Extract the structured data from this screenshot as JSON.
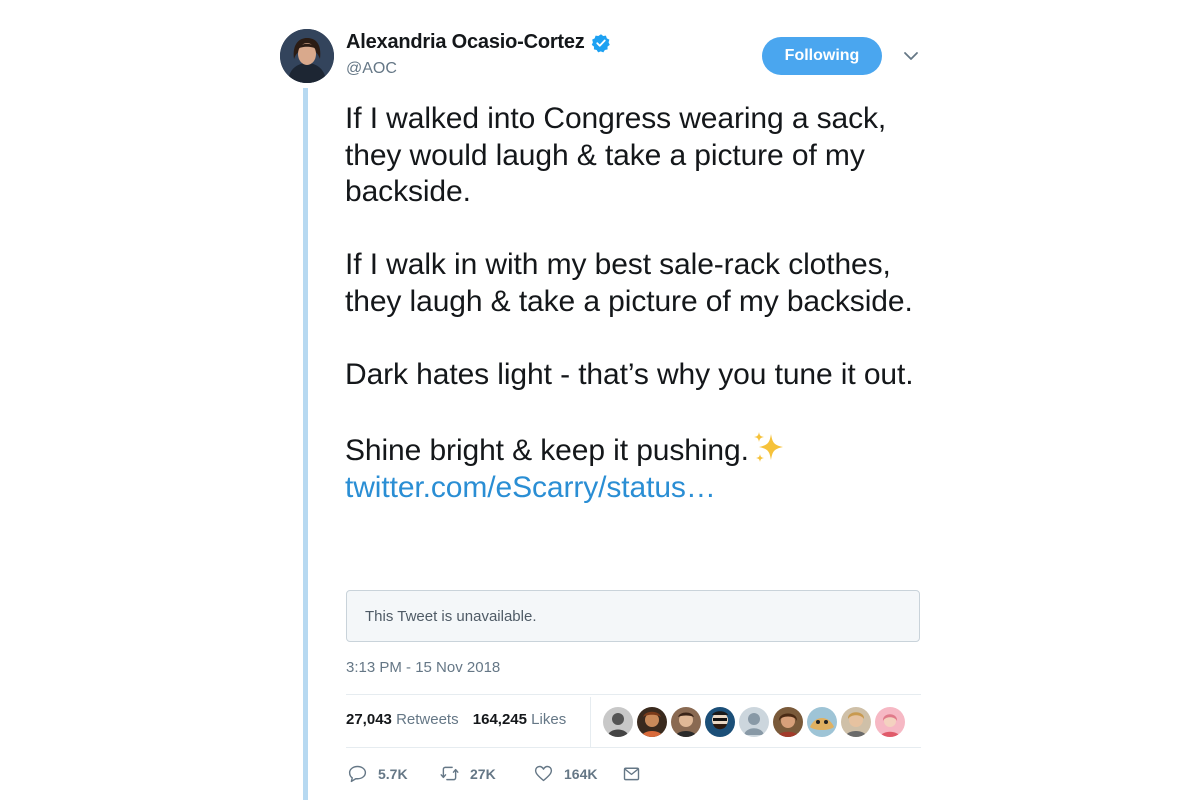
{
  "author": {
    "name": "Alexandria Ocasio-Cortez",
    "handle": "@AOC",
    "avatar_icon": "profile-photo"
  },
  "follow_button_label": "Following",
  "tweet": {
    "paragraphs": [
      "If I walked into Congress wearing a sack, they would laugh & take a picture of my backside.",
      "If I walk in with my best sale-rack clothes, they laugh & take a picture of my backside.",
      "Dark hates light - that’s why you tune it out.",
      "Shine bright & keep it pushing."
    ],
    "emoji": "sparkles",
    "link": "twitter.com/eScarry/status…"
  },
  "quote_card": {
    "text": "This Tweet is unavailable."
  },
  "timestamp": "3:13 PM - 15 Nov 2018",
  "stats": {
    "retweets_count": "27,043",
    "retweets_label": "Retweets",
    "likes_count": "164,245",
    "likes_label": "Likes"
  },
  "likers": [
    "liker-1",
    "liker-2",
    "liker-3",
    "liker-4",
    "liker-5",
    "liker-6",
    "liker-7",
    "liker-8",
    "liker-9"
  ],
  "actions": {
    "reply_count": "5.7K",
    "retweet_count": "27K",
    "like_count": "164K"
  },
  "colors": {
    "follow_button": "#4aa6ef",
    "link": "#2a8ed4",
    "thread_line": "#b7d9f1",
    "secondary_text": "#657786"
  }
}
